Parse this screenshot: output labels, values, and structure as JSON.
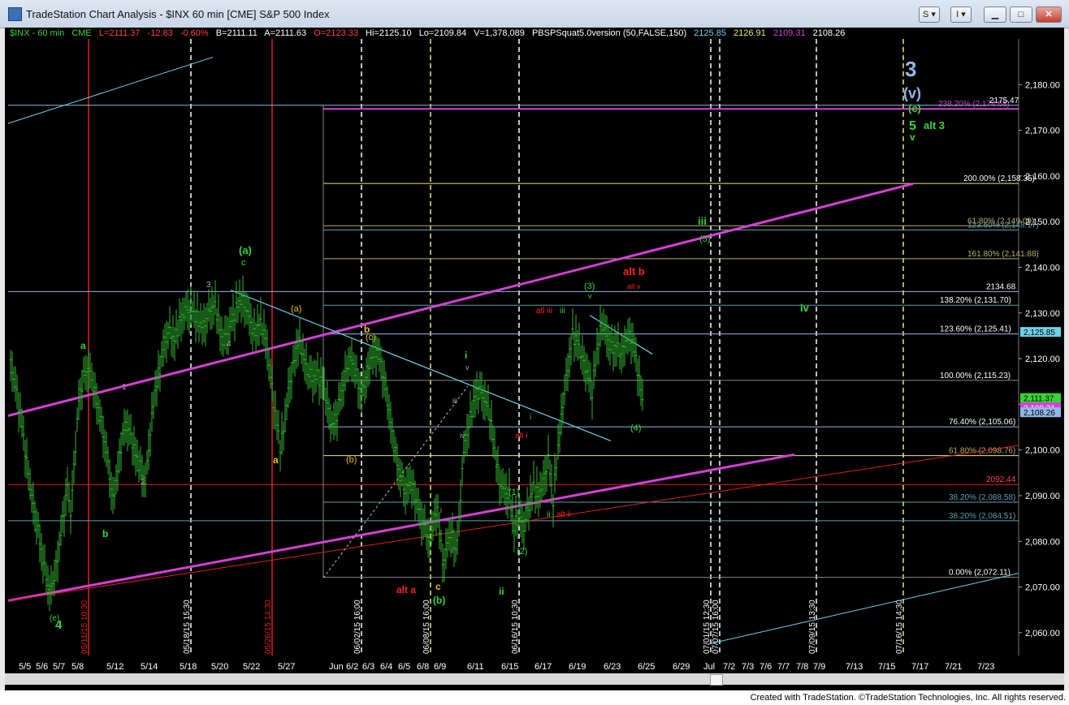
{
  "window": {
    "title": "TradeStation Chart Analysis - $INX 60 min [CME] S&P 500 Index",
    "buttons": {
      "s": "S",
      "i": "I"
    }
  },
  "header": {
    "symbol": "$INX - 60 min",
    "exchange": "CME",
    "last": "L=2111.37",
    "change": "-12.83",
    "change_pct": "-0.60%",
    "bid": "B=2111.11",
    "ask": "A=2111.63",
    "open": "O=2123.33",
    "high": "Hi=2125.10",
    "low": "Lo=2109.84",
    "volume": "V=1,378,089",
    "study": "PBSPSquat5.0version (50,FALSE,150)",
    "study_values": [
      "2125.85",
      "2126.91",
      "2109.31",
      "2108.26"
    ]
  },
  "credits": "Created with TradeStation. ©TradeStation Technologies, Inc. All rights reserved.",
  "colors": {
    "background": "#000000",
    "bars": "#2fb52f",
    "channel": "#d63fd6",
    "trend": "#6fd0e8",
    "fib": "#e8e87a",
    "red": "#e02020"
  },
  "chart_data": {
    "type": "ohlc",
    "instrument": "$INX",
    "interval": "60 min",
    "ylim": [
      2055,
      2190
    ],
    "y_ticks": [
      "2,180.00",
      "2,170.00",
      "2,160.00",
      "2,150.00",
      "2,140.00",
      "2,130.00",
      "2,120.00",
      "2,110.00",
      "2,100.00",
      "2,090.00",
      "2,080.00",
      "2,070.00",
      "2,060.00"
    ],
    "x_ticks": [
      "5/5",
      "5/6",
      "5/7",
      "5/8",
      "5/12",
      "5/14",
      "5/18",
      "5/20",
      "5/22",
      "5/27",
      "Jun",
      "6/2",
      "6/3",
      "6/4",
      "6/5",
      "6/8",
      "6/9",
      "6/11",
      "6/15",
      "6/17",
      "6/19",
      "6/23",
      "6/25",
      "6/29",
      "Jul",
      "7/2",
      "7/3",
      "7/6",
      "7/7",
      "7/8",
      "7/9",
      "7/13",
      "7/15",
      "7/17",
      "7/21",
      "7/23"
    ],
    "price_path": [
      [
        0,
        2119
      ],
      [
        6,
        2114
      ],
      [
        12,
        2108
      ],
      [
        18,
        2100
      ],
      [
        24,
        2092
      ],
      [
        30,
        2086
      ],
      [
        36,
        2080
      ],
      [
        42,
        2074
      ],
      [
        48,
        2069
      ],
      [
        54,
        2072
      ],
      [
        60,
        2079
      ],
      [
        66,
        2087
      ],
      [
        70,
        2092
      ],
      [
        74,
        2086
      ],
      [
        78,
        2096
      ],
      [
        84,
        2111
      ],
      [
        90,
        2116
      ],
      [
        96,
        2118
      ],
      [
        102,
        2114
      ],
      [
        108,
        2109
      ],
      [
        114,
        2104
      ],
      [
        120,
        2097
      ],
      [
        126,
        2089
      ],
      [
        130,
        2093
      ],
      [
        136,
        2101
      ],
      [
        142,
        2106
      ],
      [
        148,
        2103
      ],
      [
        154,
        2099
      ],
      [
        160,
        2096
      ],
      [
        166,
        2093
      ],
      [
        172,
        2104
      ],
      [
        178,
        2113
      ],
      [
        184,
        2118
      ],
      [
        190,
        2124
      ],
      [
        196,
        2126
      ],
      [
        202,
        2124
      ],
      [
        208,
        2128
      ],
      [
        214,
        2130
      ],
      [
        220,
        2131
      ],
      [
        226,
        2130
      ],
      [
        232,
        2128
      ],
      [
        238,
        2127
      ],
      [
        244,
        2130
      ],
      [
        250,
        2132
      ],
      [
        256,
        2129
      ],
      [
        260,
        2124
      ],
      [
        266,
        2125
      ],
      [
        272,
        2128
      ],
      [
        278,
        2131
      ],
      [
        284,
        2133
      ],
      [
        290,
        2131
      ],
      [
        296,
        2128
      ],
      [
        300,
        2125
      ],
      [
        306,
        2128
      ],
      [
        312,
        2126
      ],
      [
        316,
        2122
      ],
      [
        320,
        2116
      ],
      [
        326,
        2108
      ],
      [
        332,
        2101
      ],
      [
        336,
        2104
      ],
      [
        342,
        2113
      ],
      [
        348,
        2118
      ],
      [
        354,
        2124
      ],
      [
        360,
        2121
      ],
      [
        366,
        2117
      ],
      [
        372,
        2116
      ],
      [
        378,
        2116
      ],
      [
        384,
        2115
      ],
      [
        390,
        2110
      ],
      [
        396,
        2105
      ],
      [
        402,
        2108
      ],
      [
        408,
        2113
      ],
      [
        414,
        2118
      ],
      [
        420,
        2120
      ],
      [
        426,
        2116
      ],
      [
        432,
        2112
      ],
      [
        438,
        2116
      ],
      [
        444,
        2120
      ],
      [
        450,
        2122
      ],
      [
        456,
        2119
      ],
      [
        462,
        2113
      ],
      [
        468,
        2106
      ],
      [
        474,
        2099
      ],
      [
        480,
        2094
      ],
      [
        486,
        2091
      ],
      [
        492,
        2093
      ],
      [
        498,
        2090
      ],
      [
        504,
        2086
      ],
      [
        510,
        2083
      ],
      [
        516,
        2080
      ],
      [
        520,
        2084
      ],
      [
        526,
        2087
      ],
      [
        532,
        2075
      ],
      [
        536,
        2078
      ],
      [
        542,
        2082
      ],
      [
        548,
        2078
      ],
      [
        552,
        2084
      ],
      [
        556,
        2096
      ],
      [
        560,
        2102
      ],
      [
        566,
        2107
      ],
      [
        572,
        2112
      ],
      [
        578,
        2113
      ],
      [
        584,
        2111
      ],
      [
        590,
        2108
      ],
      [
        596,
        2100
      ],
      [
        602,
        2093
      ],
      [
        608,
        2091
      ],
      [
        614,
        2090
      ],
      [
        620,
        2083
      ],
      [
        626,
        2086
      ],
      [
        632,
        2083
      ],
      [
        638,
        2088
      ],
      [
        644,
        2092
      ],
      [
        650,
        2090
      ],
      [
        656,
        2093
      ],
      [
        662,
        2098
      ],
      [
        668,
        2089
      ],
      [
        674,
        2101
      ],
      [
        680,
        2110
      ],
      [
        686,
        2118
      ],
      [
        692,
        2125
      ],
      [
        698,
        2124
      ],
      [
        704,
        2120
      ],
      [
        710,
        2117
      ],
      [
        716,
        2113
      ],
      [
        722,
        2122
      ],
      [
        728,
        2128
      ],
      [
        734,
        2125
      ],
      [
        740,
        2122
      ],
      [
        746,
        2123
      ],
      [
        752,
        2121
      ],
      [
        758,
        2124
      ],
      [
        764,
        2125
      ],
      [
        770,
        2120
      ],
      [
        776,
        2113
      ],
      [
        779,
        2111
      ]
    ],
    "horizontal_levels": [
      {
        "label": "238.20% (2,174.68)",
        "value": 2174.68
      },
      {
        "label": "2175.47",
        "value": 2175.47
      },
      {
        "label": "200.00% (2,158.35)",
        "value": 2158.35
      },
      {
        "label": "61.80% (2,149.09)",
        "value": 2149.09
      },
      {
        "label": "123.60% (2,148.17)",
        "value": 2148.17
      },
      {
        "label": "161.80% (2,141.88)",
        "value": 2141.88
      },
      {
        "label": "2134.68",
        "value": 2134.68
      },
      {
        "label": "138.20% (2,131.70)",
        "value": 2131.7
      },
      {
        "label": "123.60% (2,125.41)",
        "value": 2125.41
      },
      {
        "label": "100.00% (2,115.23)",
        "value": 2115.23
      },
      {
        "label": "76.40% (2,105.06)",
        "value": 2105.06
      },
      {
        "label": "61.80% (2,098.76)",
        "value": 2098.76
      },
      {
        "label": "2092.44",
        "value": 2092.44
      },
      {
        "label": "38.20% (2,088.58)",
        "value": 2088.58
      },
      {
        "label": "38.20% (2,084.51)",
        "value": 2084.51
      },
      {
        "label": "0.00% (2,072.11)",
        "value": 2072.11
      }
    ],
    "price_badges": [
      {
        "label": "2,125.85",
        "value": 2125.85
      },
      {
        "label": "2,111.37",
        "value": 2111.37
      },
      {
        "label": "2,109.31",
        "value": 2109.31
      },
      {
        "label": "2,108.26",
        "value": 2108.26
      }
    ],
    "time_markers": [
      "05/11/15 10:30",
      "05/18/15 15:30",
      "05/26/15 14:30",
      "06/02/15 16:00",
      "06/08/15 16:00",
      "06/16/15 10:30",
      "07/01/15 12:30",
      "07/07/15 16:00",
      "07/09/15 13:30",
      "07/16/15 14:30"
    ],
    "wave_labels": [
      "4",
      "(e)",
      "a",
      "b",
      "1",
      "2",
      "3",
      "4",
      "(a)",
      "c",
      "a",
      "(a)",
      "b",
      "(c)",
      "(b)",
      "alt a",
      "c",
      "(b)",
      "i",
      "ii",
      "iii",
      "iv",
      "v",
      "i",
      "ii",
      "alt i",
      "(1)",
      "(2)",
      "ii",
      "i",
      "alt ii",
      "atl iii",
      "iii",
      "(3)",
      "v",
      "alt b",
      "alt v",
      "(4)",
      "iii",
      "(5)",
      "iv",
      "3",
      "(v)",
      "(c)",
      "5",
      "alt 3",
      "v"
    ]
  }
}
